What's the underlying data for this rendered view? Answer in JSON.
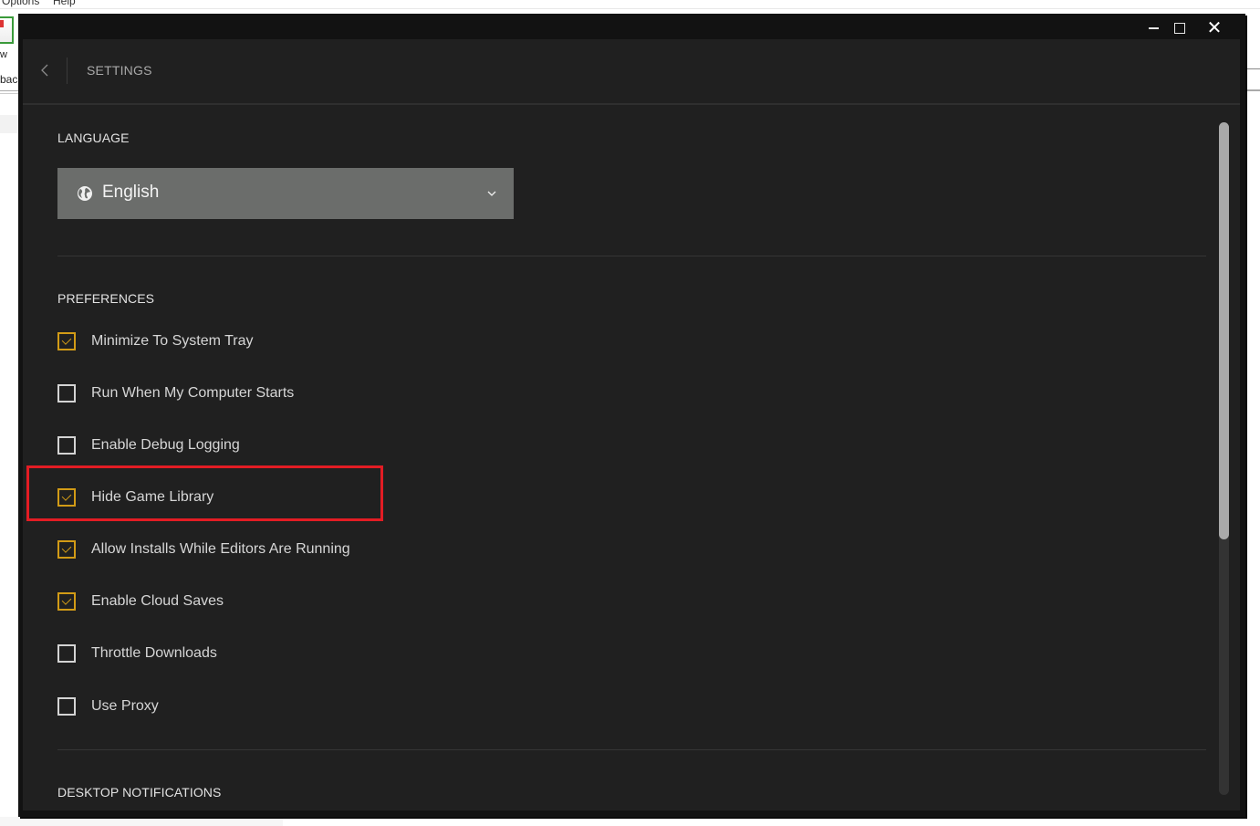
{
  "background_app": {
    "menu_items": [
      "Options",
      "Help"
    ],
    "fragments": [
      "w",
      "back"
    ]
  },
  "window": {
    "controls": {
      "minimize": "minimize-icon",
      "maximize": "maximize-icon",
      "close": "close-icon"
    }
  },
  "header": {
    "back_icon": "chevron-left-icon",
    "title": "SETTINGS"
  },
  "language": {
    "section_title": "LANGUAGE",
    "icon": "globe-icon",
    "selected": "English"
  },
  "preferences": {
    "section_title": "PREFERENCES",
    "items": [
      {
        "label": "Minimize To System Tray",
        "checked": true
      },
      {
        "label": "Run When My Computer Starts",
        "checked": false
      },
      {
        "label": "Enable Debug Logging",
        "checked": false
      },
      {
        "label": "Hide Game Library",
        "checked": true,
        "highlighted": true
      },
      {
        "label": "Allow Installs While Editors Are Running",
        "checked": true
      },
      {
        "label": "Enable Cloud Saves",
        "checked": true
      },
      {
        "label": "Throttle Downloads",
        "checked": false
      },
      {
        "label": "Use Proxy",
        "checked": false
      }
    ]
  },
  "desktop_notifications": {
    "section_title": "DESKTOP NOTIFICATIONS"
  },
  "colors": {
    "accent": "#d29b16",
    "highlight_box": "#e31c24",
    "window_bg": "#202020",
    "select_bg": "#6b6d6b"
  },
  "scroll": {
    "position_fraction": 0.0,
    "visible_fraction": 0.62
  }
}
